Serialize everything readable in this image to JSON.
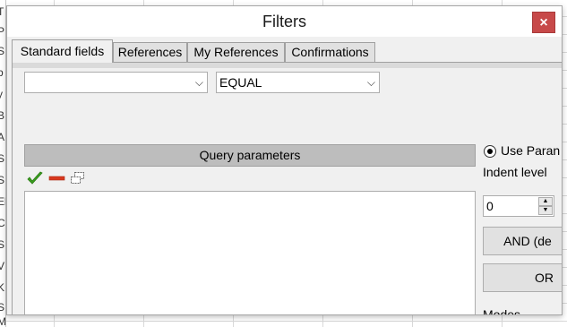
{
  "dialog": {
    "title": "Filters",
    "close_label": "×"
  },
  "tabs": [
    {
      "label": "Standard fields",
      "active": true
    },
    {
      "label": "References",
      "active": false
    },
    {
      "label": "My References",
      "active": false
    },
    {
      "label": "Confirmations",
      "active": false
    }
  ],
  "filter": {
    "field_value": "",
    "operator_value": "EQUAL"
  },
  "query": {
    "header": "Query parameters"
  },
  "side": {
    "use_param_label": "Use Paran",
    "indent_label": "Indent level",
    "indent_value": "0",
    "and_label": "AND (de",
    "or_label": "OR",
    "modes_label": "Modes"
  },
  "background": {
    "row_letters": [
      "T",
      "P",
      "S",
      "b",
      "y",
      "B",
      "A",
      "S",
      "S",
      "El",
      "C",
      "S",
      "V",
      "K",
      "S",
      "M"
    ]
  },
  "colors": {
    "close_bg": "#c74949",
    "header_bg": "#bdbdbd",
    "check_green": "#3aa11e",
    "remove_red": "#d9381e"
  }
}
